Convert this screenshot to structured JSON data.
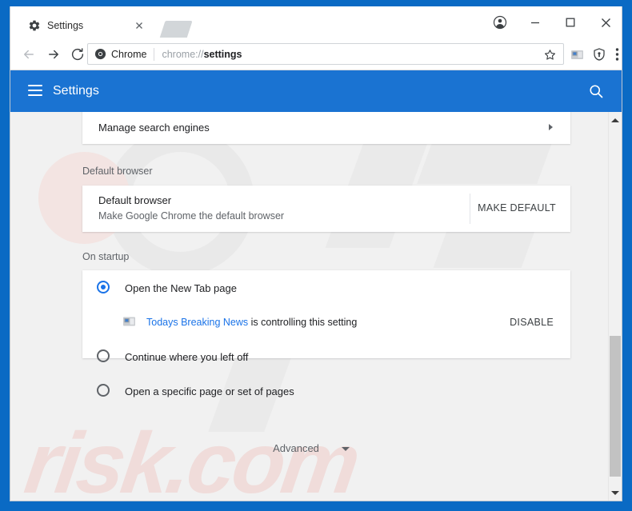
{
  "window": {
    "caption_buttons": [
      {
        "name": "profile-avatar-button",
        "icon": "profile-avatar-icon",
        "label": ""
      },
      {
        "name": "minimize-button",
        "icon": "minimize-icon",
        "label": ""
      },
      {
        "name": "maximize-button",
        "icon": "maximize-icon",
        "label": ""
      },
      {
        "name": "close-button",
        "icon": "close-icon",
        "label": ""
      }
    ]
  },
  "tabstrip": {
    "tab": {
      "title": "Settings",
      "favicon": "gear-icon",
      "close_icon": "close-icon"
    },
    "new_tab_button_label": ""
  },
  "toolbar": {
    "back_icon": "arrow-left-icon",
    "forward_icon": "arrow-right-icon",
    "reload_icon": "reload-icon",
    "omnibox": {
      "security_chip_icon": "chrome-logo-icon",
      "security_chip_label": "Chrome",
      "url_prefix": "chrome://",
      "url_main": "settings",
      "full_url": "chrome://settings",
      "star_icon": "star-outline-icon"
    },
    "actions": [
      {
        "name": "extension-icon-button",
        "icon": "extension-puzzle-icon"
      },
      {
        "name": "shield-icon-button",
        "icon": "shield-icon"
      },
      {
        "name": "chrome-menu-button",
        "icon": "three-dot-menu-icon"
      }
    ]
  },
  "settings_header": {
    "menu_icon": "hamburger-menu-icon",
    "title": "Settings",
    "search_icon": "search-icon",
    "background_color": "#1a73d2"
  },
  "page": {
    "background_color": "#f1f1f1",
    "watermark_text": "risk.com",
    "search_engines_card": {
      "row_label": "Manage search engines",
      "chevron_icon": "chevron-right-icon"
    },
    "default_browser": {
      "section_label": "Default browser",
      "title": "Default browser",
      "subtitle": "Make Google Chrome the default browser",
      "action_label": "MAKE DEFAULT"
    },
    "on_startup": {
      "section_label": "On startup",
      "options": [
        {
          "label": "Open the New Tab page",
          "checked": true
        },
        {
          "label": "Continue where you left off",
          "checked": false
        },
        {
          "label": "Open a specific page or set of pages",
          "checked": false
        }
      ],
      "extension_notice": {
        "icon": "extension-puzzle-icon",
        "link_text": "Todays Breaking News",
        "rest_text": " is controlling this setting",
        "action_label": "DISABLE",
        "link_color": "#1a73e8"
      }
    },
    "advanced": {
      "label": "Advanced",
      "chevron_icon": "chevron-down-icon"
    }
  },
  "scrollbar": {
    "up_arrow_icon": "scroll-up-arrow-icon",
    "down_arrow_icon": "scroll-down-arrow-icon",
    "thumb_label": ""
  }
}
